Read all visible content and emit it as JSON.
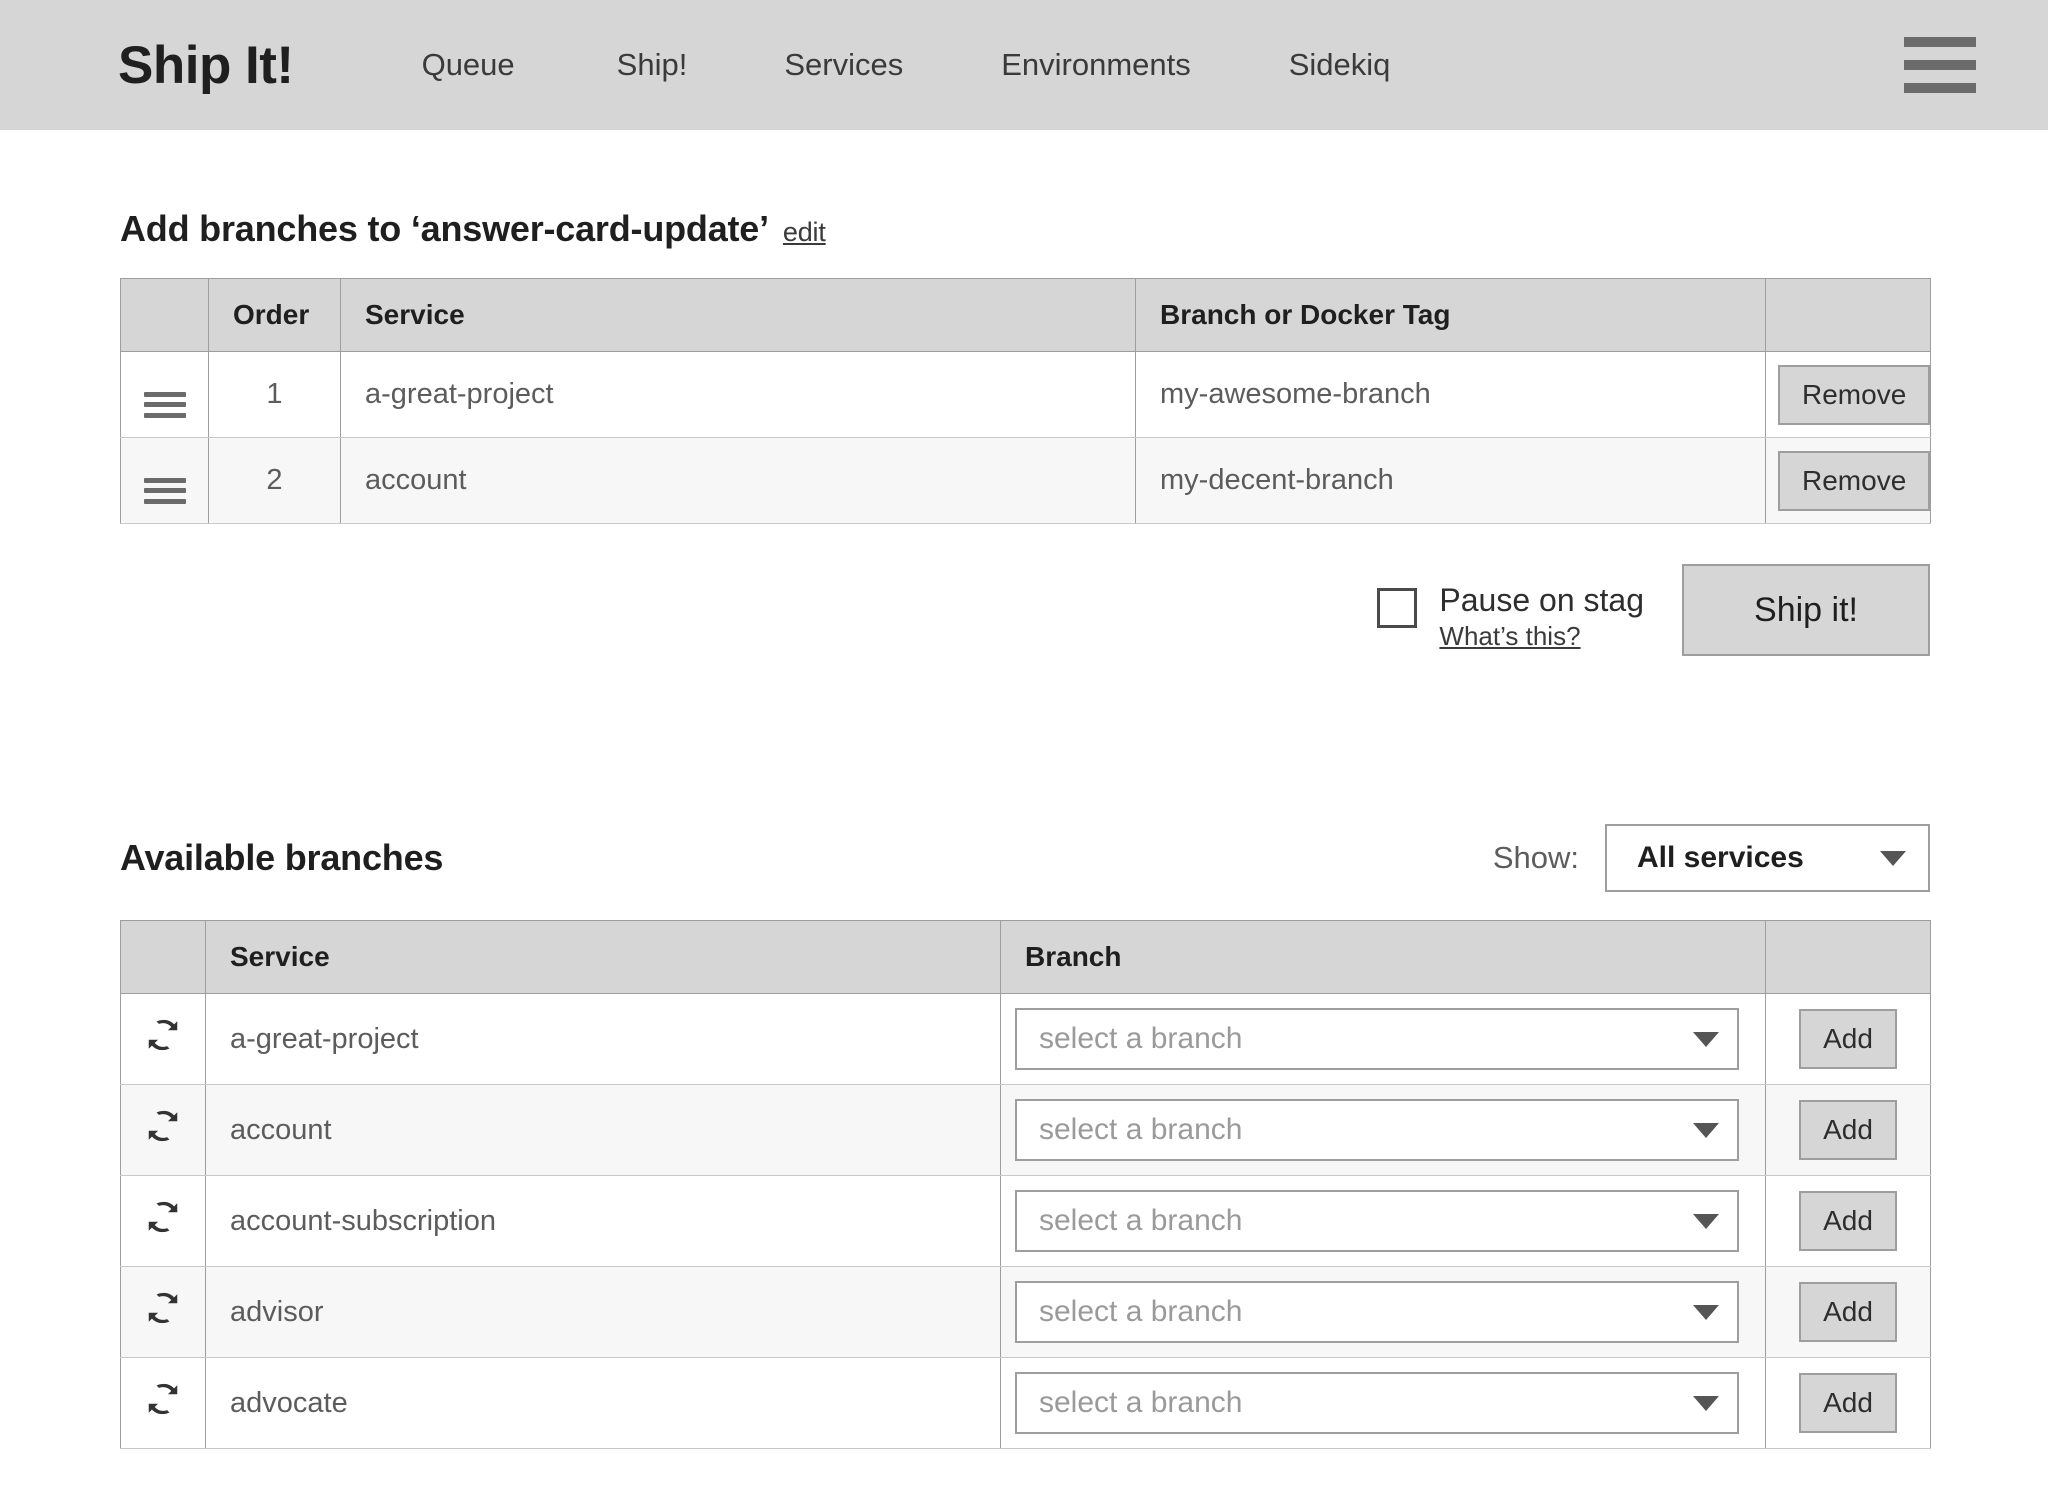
{
  "header": {
    "brand": "Ship It!",
    "nav": [
      {
        "label": "Queue"
      },
      {
        "label": "Ship!"
      },
      {
        "label": "Services"
      },
      {
        "label": "Environments"
      },
      {
        "label": "Sidekiq"
      }
    ],
    "menu_icon": "hamburger-icon"
  },
  "add_branches": {
    "title": "Add branches to ‘answer-card-update’",
    "edit_label": "edit",
    "columns": [
      "",
      "Order",
      "Service",
      "Branch or Docker Tag",
      ""
    ],
    "rows": [
      {
        "order": "1",
        "service": "a-great-project",
        "branch": "my-awesome-branch",
        "action": "Remove"
      },
      {
        "order": "2",
        "service": "account",
        "branch": "my-decent-branch",
        "action": "Remove"
      }
    ]
  },
  "actions": {
    "pause_label": "Pause on stag",
    "pause_checked": false,
    "whats_this": "What’s this?",
    "ship_label": "Ship it!"
  },
  "available": {
    "title": "Available branches",
    "show_label": "Show:",
    "show_value": "All services",
    "columns": [
      "",
      "Service",
      "Branch",
      ""
    ],
    "select_placeholder": "select a branch",
    "add_label": "Add",
    "rows": [
      {
        "service": "a-great-project"
      },
      {
        "service": "account"
      },
      {
        "service": "account-subscription"
      },
      {
        "service": "advisor"
      },
      {
        "service": "advocate"
      }
    ]
  },
  "colors": {
    "header_bg": "#d6d6d6",
    "table_header_bg": "#d6d6d6",
    "border": "#9e9e9e",
    "row_alt": "#f7f7f7",
    "text": "#5c5c5c",
    "heading": "#1f1f1f"
  }
}
